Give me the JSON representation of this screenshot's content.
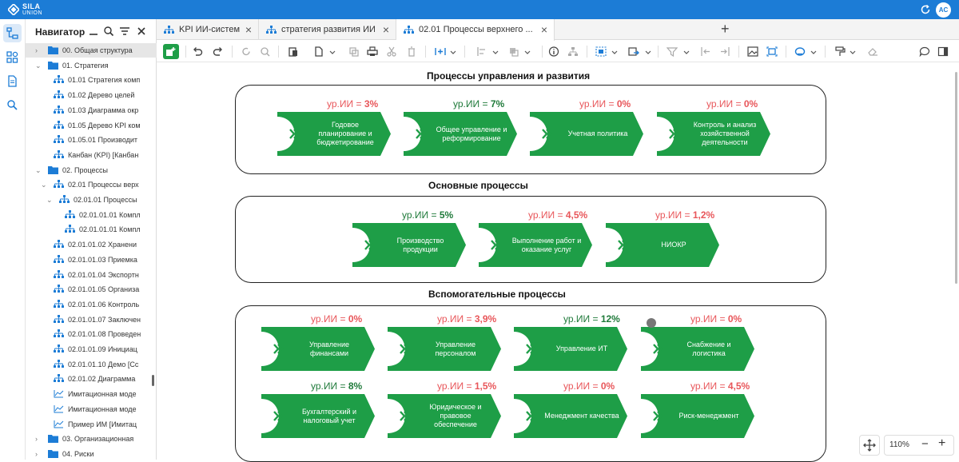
{
  "app": {
    "logo_line1": "SILA",
    "logo_line2": "UNION",
    "user_initials": "AC",
    "brand_color": "#1c7cd6",
    "process_color": "#1e9e47"
  },
  "navigator": {
    "title": "Навигатор",
    "items": [
      {
        "label": "00. Общая структура",
        "icon": "folder-icon",
        "selected": true
      },
      {
        "label": "01. Стратегия",
        "icon": "folder-icon"
      },
      {
        "label": "01.01 Стратегия комп",
        "icon": "hierarchy-icon"
      },
      {
        "label": "01.02 Дерево целей",
        "icon": "hierarchy-icon"
      },
      {
        "label": "01.03 Диаграмма окр",
        "icon": "hierarchy-icon"
      },
      {
        "label": "01.05 Дерево KPI ком",
        "icon": "hierarchy-icon"
      },
      {
        "label": "01.05.01 Производит",
        "icon": "hierarchy-icon"
      },
      {
        "label": "Канбан (KPI) [Канбан",
        "icon": "hierarchy-icon"
      },
      {
        "label": "02. Процессы",
        "icon": "folder-icon"
      },
      {
        "label": "02.01 Процессы верх",
        "icon": "hierarchy-icon"
      },
      {
        "label": "02.01.01 Процессы",
        "icon": "hierarchy-icon"
      },
      {
        "label": "02.01.01.01 Компл",
        "icon": "hierarchy-icon"
      },
      {
        "label": "02.01.01.01 Компл",
        "icon": "hierarchy-icon"
      },
      {
        "label": "02.01.01.02 Хранени",
        "icon": "hierarchy-icon"
      },
      {
        "label": "02.01.01.03 Приемка",
        "icon": "hierarchy-icon"
      },
      {
        "label": "02.01.01.04 Экспортн",
        "icon": "hierarchy-icon"
      },
      {
        "label": "02.01.01.05 Организа",
        "icon": "hierarchy-icon"
      },
      {
        "label": "02.01.01.06 Контроль",
        "icon": "hierarchy-icon"
      },
      {
        "label": "02.01.01.07 Заключен",
        "icon": "hierarchy-icon"
      },
      {
        "label": "02.01.01.08 Проведен",
        "icon": "hierarchy-icon"
      },
      {
        "label": "02.01.01.09 Инициац",
        "icon": "hierarchy-icon"
      },
      {
        "label": "02.01.01.10 Демо [Сс",
        "icon": "hierarchy-icon"
      },
      {
        "label": "02.01.02 Диаграмма",
        "icon": "hierarchy-icon"
      },
      {
        "label": "Имитационная моде",
        "icon": "chart-icon"
      },
      {
        "label": "Имитационная моде",
        "icon": "chart-icon"
      },
      {
        "label": "Пример ИМ [Имитац",
        "icon": "chart-icon"
      },
      {
        "label": "03. Организационная",
        "icon": "folder-icon"
      },
      {
        "label": "04. Риски",
        "icon": "folder-icon"
      }
    ]
  },
  "tabs": [
    {
      "label": "KPI ИИ-систем"
    },
    {
      "label": "стратегия развития ИИ"
    },
    {
      "label": "02.01 Процессы верхнего ..."
    }
  ],
  "diagram": {
    "level_prefix": "ур.ИИ = ",
    "sections": [
      {
        "title": "Процессы управления и развития",
        "processes": [
          {
            "label": "Годовое планирование и бюджетирование",
            "level": "3%",
            "level_color": "red"
          },
          {
            "label": "Общее управление и реформирование",
            "level": "7%",
            "level_color": "green"
          },
          {
            "label": "Учетная политика",
            "level": "0%",
            "level_color": "red"
          },
          {
            "label": "Контроль и анализ хозяйственной деятельности",
            "level": "0%",
            "level_color": "red"
          }
        ]
      },
      {
        "title": "Основные процессы",
        "processes": [
          {
            "label": "Производство продукции",
            "level": "5%",
            "level_color": "green"
          },
          {
            "label": "Выполнение работ и оказание услуг",
            "level": "4,5%",
            "level_color": "red"
          },
          {
            "label": "НИОКР",
            "level": "1,2%",
            "level_color": "red"
          }
        ]
      },
      {
        "title": "Вспомогательные процессы",
        "processes": [
          {
            "label": "Управление финансами",
            "level": "0%",
            "level_color": "red"
          },
          {
            "label": "Управление персоналом",
            "level": "3,9%",
            "level_color": "red"
          },
          {
            "label": "Управление ИТ",
            "level": "12%",
            "level_color": "green"
          },
          {
            "label": "Снабжение и логистика",
            "level": "0%",
            "level_color": "red"
          },
          {
            "label": "Бухгалтерский и налоговый учет",
            "level": "8%",
            "level_color": "green"
          },
          {
            "label": "Юридическое и правовое обеспечение",
            "level": "1,5%",
            "level_color": "red"
          },
          {
            "label": "Менеджмент качества",
            "level": "0%",
            "level_color": "red"
          },
          {
            "label": "Риск-менеджмент",
            "level": "4,5%",
            "level_color": "red"
          }
        ]
      }
    ]
  },
  "zoom": {
    "value": "110%",
    "minus": "−",
    "plus": "+"
  }
}
